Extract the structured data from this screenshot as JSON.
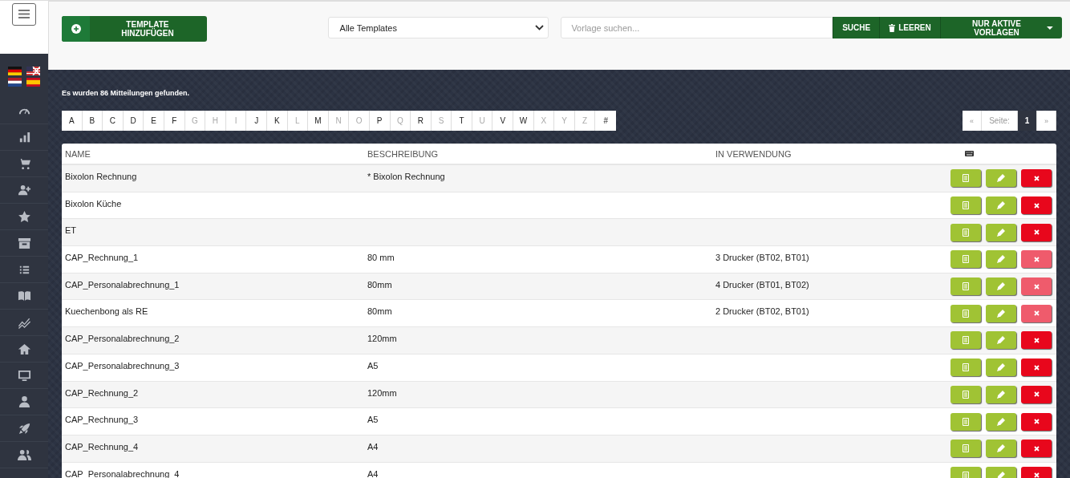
{
  "toolbar": {
    "add_button": "TEMPLATE HINZUFÜGEN",
    "filter_select": "Alle Templates",
    "search": {
      "placeholder": "Vorlage suchen..."
    },
    "search_button": "SUCHE",
    "clear_button": "LEEREN",
    "active_button": "NUR AKTIVE VORLAGEN"
  },
  "result_text": "Es wurden 86 Mitteilungen gefunden.",
  "letters": [
    {
      "label": "A",
      "disabled": false
    },
    {
      "label": "B",
      "disabled": false
    },
    {
      "label": "C",
      "disabled": false
    },
    {
      "label": "D",
      "disabled": false
    },
    {
      "label": "E",
      "disabled": false
    },
    {
      "label": "F",
      "disabled": false
    },
    {
      "label": "G",
      "disabled": true
    },
    {
      "label": "H",
      "disabled": true
    },
    {
      "label": "I",
      "disabled": true
    },
    {
      "label": "J",
      "disabled": false
    },
    {
      "label": "K",
      "disabled": false
    },
    {
      "label": "L",
      "disabled": true
    },
    {
      "label": "M",
      "disabled": false
    },
    {
      "label": "N",
      "disabled": true
    },
    {
      "label": "O",
      "disabled": true
    },
    {
      "label": "P",
      "disabled": false
    },
    {
      "label": "Q",
      "disabled": true
    },
    {
      "label": "R",
      "disabled": false
    },
    {
      "label": "S",
      "disabled": true
    },
    {
      "label": "T",
      "disabled": false
    },
    {
      "label": "U",
      "disabled": true
    },
    {
      "label": "V",
      "disabled": false
    },
    {
      "label": "W",
      "disabled": false
    },
    {
      "label": "X",
      "disabled": true
    },
    {
      "label": "Y",
      "disabled": true
    },
    {
      "label": "Z",
      "disabled": true
    },
    {
      "label": "#",
      "disabled": false
    }
  ],
  "pagination": {
    "prev": "«",
    "label": "Seite:",
    "page": "1",
    "next": "»"
  },
  "table": {
    "columns": [
      "NAME",
      "BESCHREIBUNG",
      "IN VERWENDUNG"
    ],
    "rows": [
      {
        "name": "Bixolon Rechnung",
        "description": "* Bixolon Rechnung",
        "delete_disabled": false
      },
      {
        "name": "Bixolon Küche",
        "delete_disabled": false
      },
      {
        "name": "ET",
        "delete_disabled": false
      },
      {
        "name": "CAP_Rechnung_1",
        "description": "80 mm",
        "usage": "3 Drucker (BT02, BT01)",
        "delete_disabled": true
      },
      {
        "name": "CAP_Personalabrechnung_1",
        "description": "80mm",
        "usage": "4 Drucker (BT01, BT02)",
        "delete_disabled": true
      },
      {
        "name": "Kuechenbong als RE",
        "description": "80mm",
        "usage": "2 Drucker (BT02, BT01)",
        "delete_disabled": true
      },
      {
        "name": "CAP_Personalabrechnung_2",
        "description": "120mm",
        "delete_disabled": false
      },
      {
        "name": "CAP_Personalabrechnung_3",
        "description": "A5",
        "delete_disabled": false
      },
      {
        "name": "CAP_Rechnung_2",
        "description": "120mm",
        "delete_disabled": false
      },
      {
        "name": "CAP_Rechnung_3",
        "description": "A5",
        "delete_disabled": false
      },
      {
        "name": "CAP_Rechnung_4",
        "description": "A4",
        "delete_disabled": false
      },
      {
        "name": "CAP_Personalabrechnung_4",
        "description": "A4",
        "delete_disabled": false
      }
    ]
  }
}
